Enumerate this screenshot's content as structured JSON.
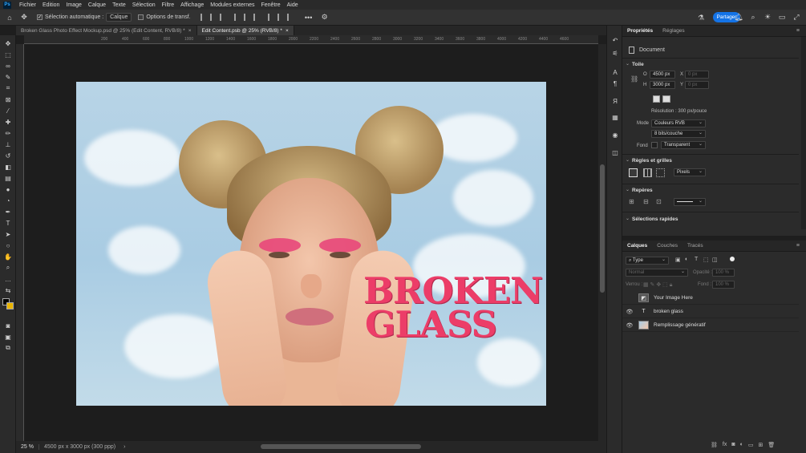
{
  "app": {
    "logo": "Ps",
    "menu": [
      "Fichier",
      "Edition",
      "Image",
      "Calque",
      "Texte",
      "Sélection",
      "Filtre",
      "Affichage",
      "Modules externes",
      "Fenêtre",
      "Aide"
    ]
  },
  "options": {
    "auto_select_label": "Sélection automatique :",
    "auto_select_value": "Calque",
    "transform_label": "Options de transf.",
    "share_label": "Partager"
  },
  "tabs": [
    {
      "label": "Broken Glass Photo Effect Mockup.psd @ 25% (Edit Content, RVB/8) *",
      "active": false
    },
    {
      "label": "Edit Content.psb @ 25% (RVB/8) *",
      "active": true
    }
  ],
  "ruler": {
    "ticks": [
      "200",
      "400",
      "600",
      "800",
      "1000",
      "1200",
      "1400",
      "1600",
      "1800",
      "2000",
      "2200",
      "2400",
      "2600",
      "2800",
      "3000",
      "3200",
      "3400",
      "3600",
      "3800",
      "4000",
      "4200",
      "4400",
      "4600"
    ]
  },
  "canvas": {
    "text_line1": "BROKEN",
    "text_line2": "GLASS",
    "text_color": "#ec3d68"
  },
  "status": {
    "zoom": "25 %",
    "info": "4500 px x 3000 px (300 ppp)"
  },
  "properties": {
    "tabs": [
      "Propriétés",
      "Réglages"
    ],
    "doc_label": "Document",
    "section_canvas": "Toile",
    "width_label": "O",
    "width_value": "4500 px",
    "height_label": "H",
    "height_value": "3000 px",
    "x_label": "X",
    "x_value": "0 px",
    "y_label": "Y",
    "y_value": "0 px",
    "resolution": "Résolution : 300 px/pouce",
    "mode_label": "Mode",
    "mode_value": "Couleurs RVB",
    "depth_value": "8 bits/couche",
    "bg_label": "Fond",
    "bg_value": "Transparent",
    "section_rulers": "Règles et grilles",
    "units_value": "Pixels",
    "section_guides": "Repères",
    "section_quick": "Sélections rapides"
  },
  "layers": {
    "tabs": [
      "Calques",
      "Couches",
      "Tracés"
    ],
    "filter_value": "Type",
    "blend_value": "Normal",
    "opacity_label": "Opacité :",
    "opacity_value": "100 %",
    "lock_label": "Verrou :",
    "fill_label": "Fond :",
    "fill_value": "100 %",
    "items": [
      {
        "name": "Your Image Here",
        "visible": false,
        "kind": "smart"
      },
      {
        "name": "broken glass",
        "visible": true,
        "kind": "text"
      },
      {
        "name": "Remplissage génératif",
        "visible": true,
        "kind": "image"
      }
    ]
  },
  "colors": {
    "accent": "#1473e6",
    "fg_swatch": "#000000",
    "bg_swatch": "#e8b400"
  }
}
